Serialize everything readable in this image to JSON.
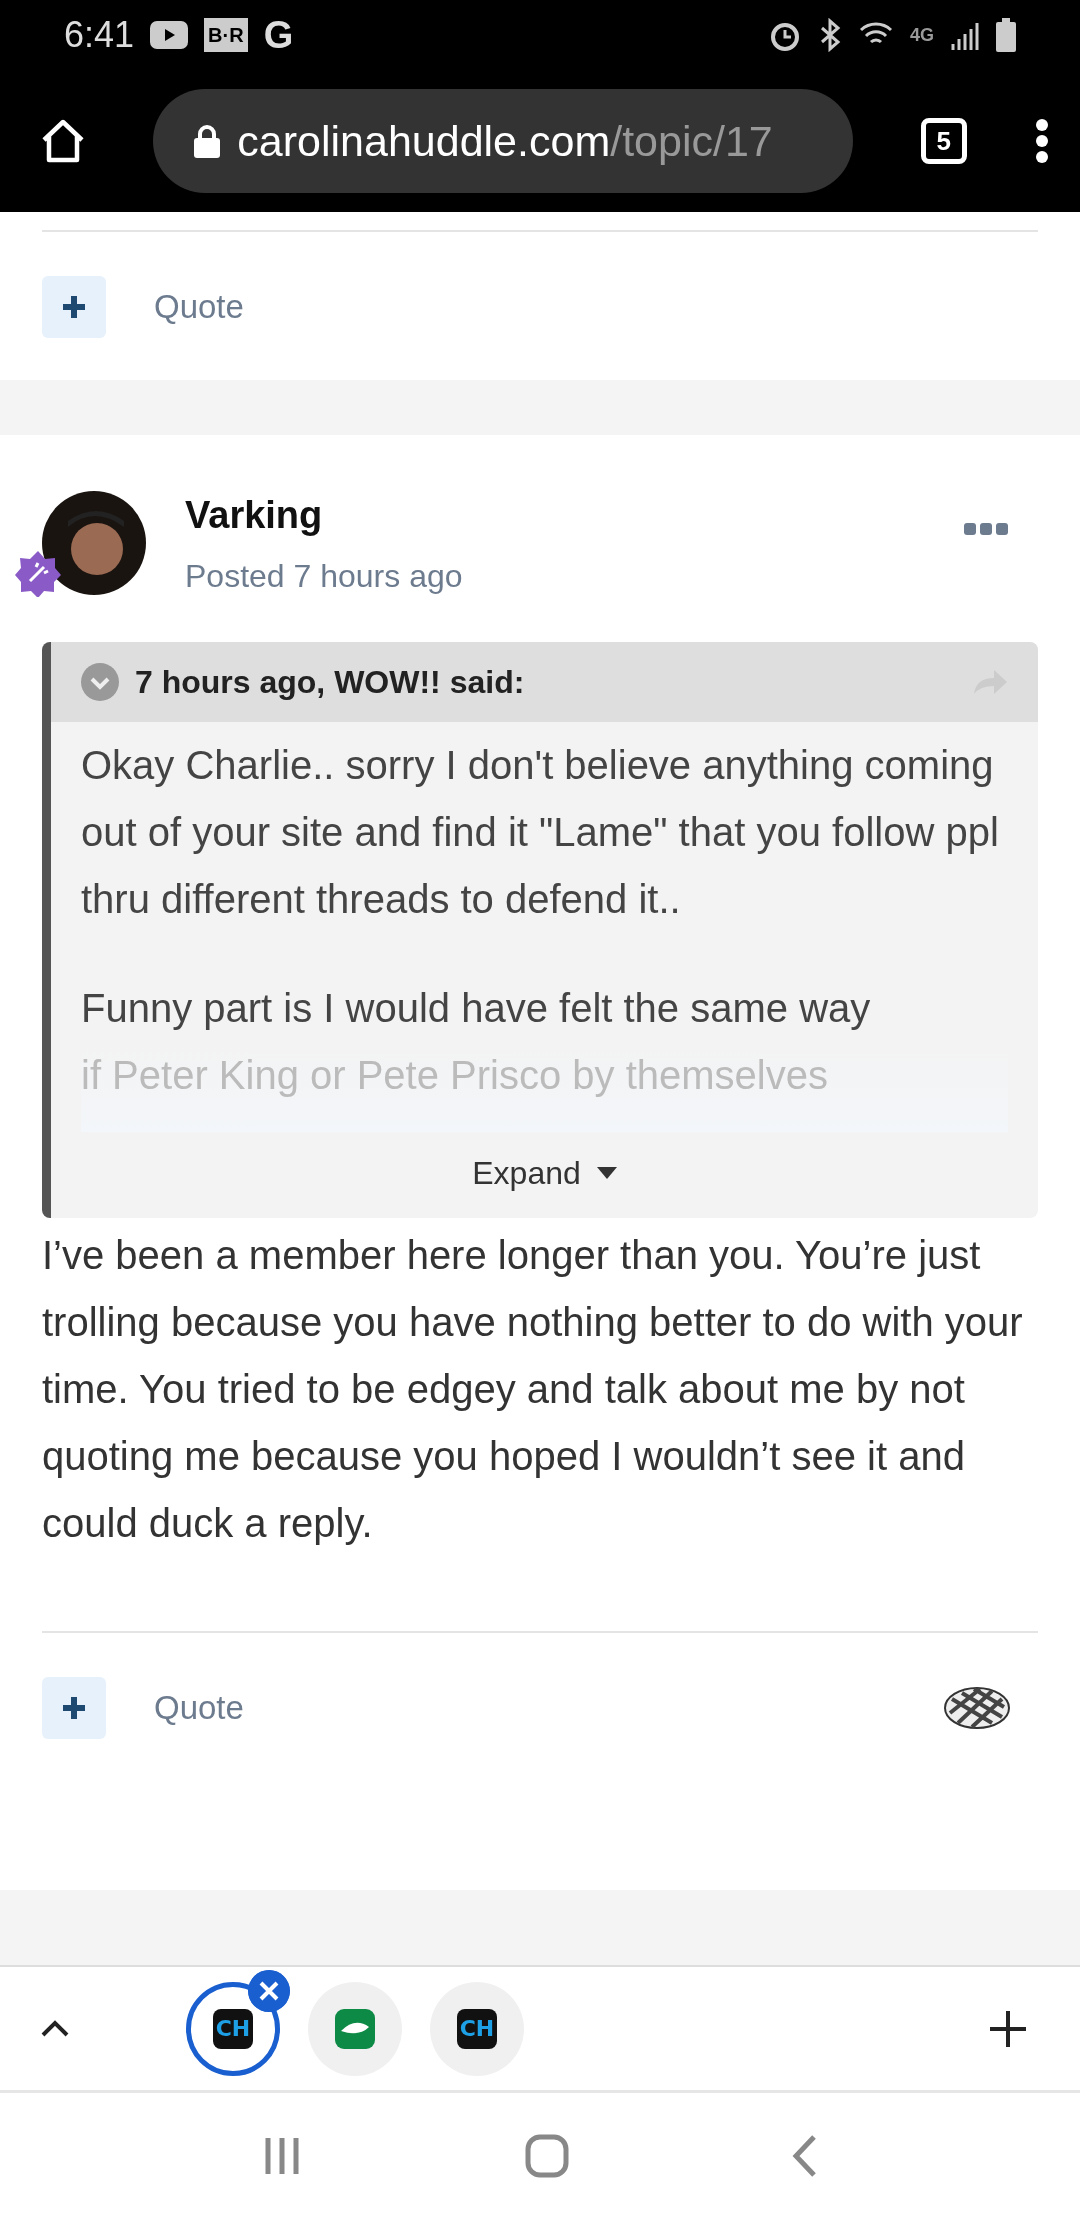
{
  "status_bar": {
    "time": "6:41",
    "app_badge": "B·R",
    "app_letter": "G",
    "network": "4G"
  },
  "browser": {
    "url_host": "carolinahuddle.com",
    "url_path": "/topic/17",
    "tab_count": "5"
  },
  "previous_post": {
    "quote_label": "Quote"
  },
  "post": {
    "author": "Varking",
    "posted": "Posted 7 hours ago",
    "quote": {
      "header": "7 hours ago, WOW!! said:",
      "paragraphs": [
        "Okay Charlie.. sorry I don't believe anything coming out of your site and find it \"Lame\" that you follow ppl thru different threads to defend it..",
        "Funny part is I would have felt the same way"
      ],
      "faded_line": "if Peter King or Pete Prisco by themselves",
      "expand": "Expand"
    },
    "body": "I’ve been a member here longer than you. You’re just trolling because you have nothing better to do with your time. You tried to be edgey and talk about me by not quoting me because you hoped I wouldn’t see it and could duck a reply.",
    "quote_label": "Quote"
  },
  "tab_strip": {
    "tabs": [
      {
        "kind": "logo",
        "label": "CH",
        "selected": true
      },
      {
        "kind": "app",
        "selected": false
      },
      {
        "kind": "logo",
        "label": "CH",
        "selected": false
      }
    ]
  }
}
